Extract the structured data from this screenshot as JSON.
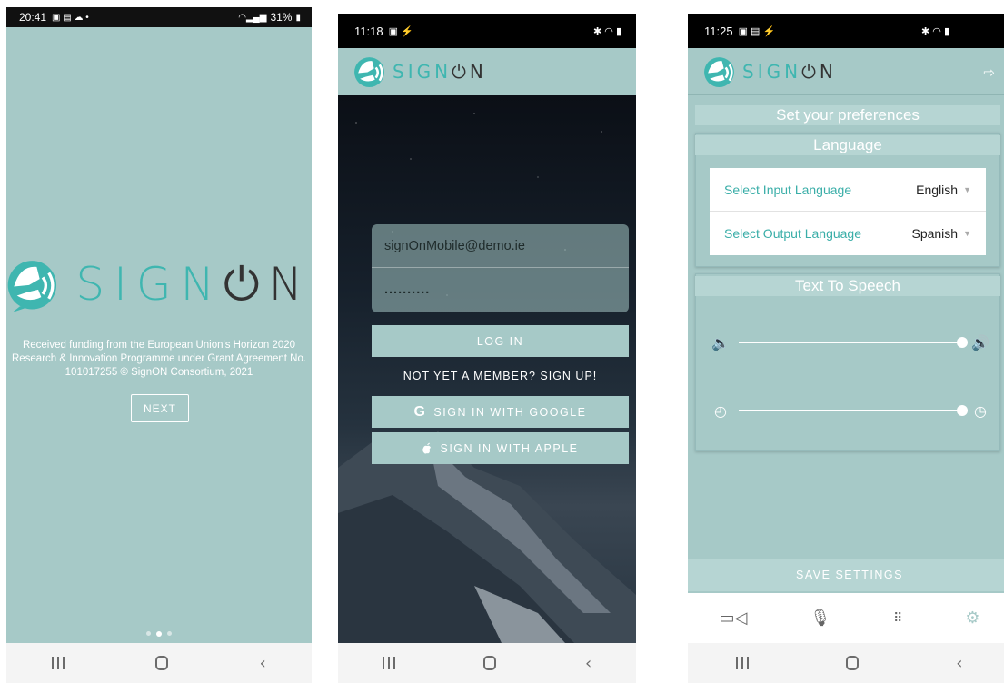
{
  "colors": {
    "brand_teal": "#a6c9c7",
    "logo_teal": "#3fb6b0",
    "dark_text": "#333333"
  },
  "screen1": {
    "status": {
      "time": "20:41",
      "icons_left": "▣ ▤ ☁ •",
      "battery": "31%"
    },
    "logo": {
      "word_light": "SIGN",
      "power_icon": "⏻",
      "word_dark": "N"
    },
    "funding_text": "Received funding from the European Union's Horizon 2020 Research & Innovation Programme under Grant Agreement No. 101017255 © SignON Consortium, 2021",
    "next_label": "NEXT",
    "pager": {
      "count": 3,
      "active": 2
    }
  },
  "screen2": {
    "status": {
      "time": "11:18",
      "icons_left": "▣ ⚡",
      "icons_right": "✱ ◠ ▮"
    },
    "logo": {
      "word_light": "SIGN",
      "power_icon": "⏻",
      "word_dark": "N"
    },
    "email_value": "signOnMobile@demo.ie",
    "password_value": "..........",
    "login_label": "LOG IN",
    "signup_label": "NOT YET A MEMBER? SIGN UP!",
    "google_label": "SIGN IN WITH GOOGLE",
    "google_icon": "G",
    "apple_label": "SIGN IN WITH APPLE",
    "apple_icon": "apple-logo"
  },
  "screen3": {
    "status": {
      "time": "11:25",
      "icons_left": "▣ ▤ ⚡",
      "icons_right": "✱ ◠ ▮"
    },
    "logo": {
      "word_light": "SIGN",
      "power_icon": "⏻",
      "word_dark": "N"
    },
    "page_title": "Set your preferences",
    "language_title": "Language",
    "input_language_label": "Select Input Language",
    "input_language_value": "English",
    "output_language_label": "Select Output Language",
    "output_language_value": "Spanish",
    "tts_title": "Text To Speech",
    "volume_level": 1.0,
    "speed_level": 1.0,
    "save_label": "SAVE SETTINGS",
    "tabs": [
      "video-camera",
      "microphone",
      "keypad",
      "settings"
    ],
    "active_tab": "settings"
  }
}
